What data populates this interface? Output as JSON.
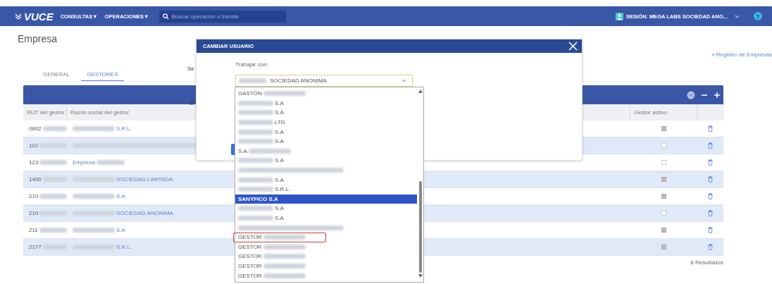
{
  "topbar": {
    "logo": "VUCE",
    "menus": [
      {
        "label": "CONSULTAS▼"
      },
      {
        "label": "OPERACIONES▼"
      }
    ],
    "search": {
      "placeholder": "Buscar operación o trámite"
    },
    "session": "SESIÓN: MEGA LABS SOCIEDAD ANO...",
    "help": "?"
  },
  "page": {
    "title": "Empresa",
    "link": "« Registro de Empresas",
    "covered_texts": [
      "Se",
      "S"
    ]
  },
  "tabs": [
    {
      "label": "GENERAL",
      "selected": false
    },
    {
      "label": "GESTORES",
      "selected": true
    }
  ],
  "table": {
    "columns": [
      "RUT del gestor",
      "Razón social del gestor",
      "Gestor activo"
    ],
    "rows": [
      {
        "rut": "0802",
        "name": "S.R.L.",
        "redacted_before": true,
        "redacted_after": false,
        "active": true
      },
      {
        "rut": "110",
        "redacted_before": true,
        "redacted_after": false,
        "active": false
      },
      {
        "rut": "123",
        "name": "Empresa",
        "redacted_before": false,
        "redacted_after": true,
        "active": false
      },
      {
        "rut": "1400",
        "name": "SOCIEDAD LIMITADA",
        "redacted_before": true,
        "redacted_after": false,
        "active": true
      },
      {
        "rut": "210",
        "name": "S.A",
        "redacted_before": true,
        "redacted_after": false,
        "active": true
      },
      {
        "rut": "210",
        "name": "SOCIEDAD ANONIMA",
        "redacted_before": true,
        "redacted_after": false,
        "active": false
      },
      {
        "rut": "211",
        "name": "S.A",
        "redacted_before": true,
        "redacted_after": false,
        "active": true
      },
      {
        "rut": "2177",
        "name": "S.R.L.",
        "redacted_before": true,
        "redacted_after": false,
        "active": true
      }
    ],
    "results": "8 Resultados"
  },
  "modal": {
    "title": "CAMBIAR USUARIO",
    "field_label": "Trabajar con:",
    "select_value": "SOCIEDAD ANONIMA",
    "options": [
      {
        "label": "GASTÓN",
        "redacted_before": false,
        "redacted_after": true,
        "selected": false,
        "outlined": false
      },
      {
        "label": "S.A",
        "redacted_before": true,
        "redacted_after": false,
        "selected": false,
        "outlined": false
      },
      {
        "label": "S.A",
        "redacted_before": true,
        "redacted_after": false,
        "selected": false,
        "outlined": false
      },
      {
        "label": "LTD",
        "redacted_before": true,
        "redacted_after": false,
        "selected": false,
        "outlined": false
      },
      {
        "label": "S.A",
        "redacted_before": true,
        "redacted_after": false,
        "selected": false,
        "outlined": false
      },
      {
        "label": "S.A",
        "redacted_before": true,
        "redacted_after": false,
        "selected": false,
        "outlined": false
      },
      {
        "label": "S.A",
        "redacted_before": false,
        "redacted_after": true,
        "selected": false,
        "outlined": false
      },
      {
        "label": "S.A",
        "redacted_before": true,
        "redacted_after": false,
        "selected": false,
        "outlined": false
      },
      {
        "redacted_before": true,
        "redacted_after": false,
        "selected": false,
        "outlined": false
      },
      {
        "label": "S.A",
        "redacted_before": true,
        "redacted_after": false,
        "selected": false,
        "outlined": false
      },
      {
        "label": "S.R.L.",
        "redacted_before": true,
        "redacted_after": false,
        "selected": false,
        "outlined": false
      },
      {
        "label": "SANYFICO S.A",
        "redacted_before": false,
        "redacted_after": false,
        "selected": true,
        "outlined": false
      },
      {
        "label": "S.A",
        "redacted_before": true,
        "redacted_after": false,
        "selected": false,
        "outlined": false
      },
      {
        "label": "S.A",
        "redacted_before": true,
        "redacted_after": false,
        "selected": false,
        "outlined": false
      },
      {
        "redacted_before": true,
        "redacted_after": false,
        "selected": false,
        "outlined": false
      },
      {
        "label": "GESTOR",
        "redacted_before": false,
        "redacted_after": true,
        "selected": false,
        "outlined": true
      },
      {
        "label": "GESTOR",
        "redacted_before": false,
        "redacted_after": true,
        "selected": false,
        "outlined": false
      },
      {
        "label": "GESTOR",
        "redacted_before": false,
        "redacted_after": true,
        "selected": false,
        "outlined": false
      },
      {
        "label": "GESTOR",
        "redacted_before": false,
        "redacted_after": true,
        "selected": false,
        "outlined": false
      },
      {
        "label": "GESTOR",
        "redacted_before": false,
        "redacted_after": true,
        "selected": false,
        "outlined": false
      }
    ]
  }
}
